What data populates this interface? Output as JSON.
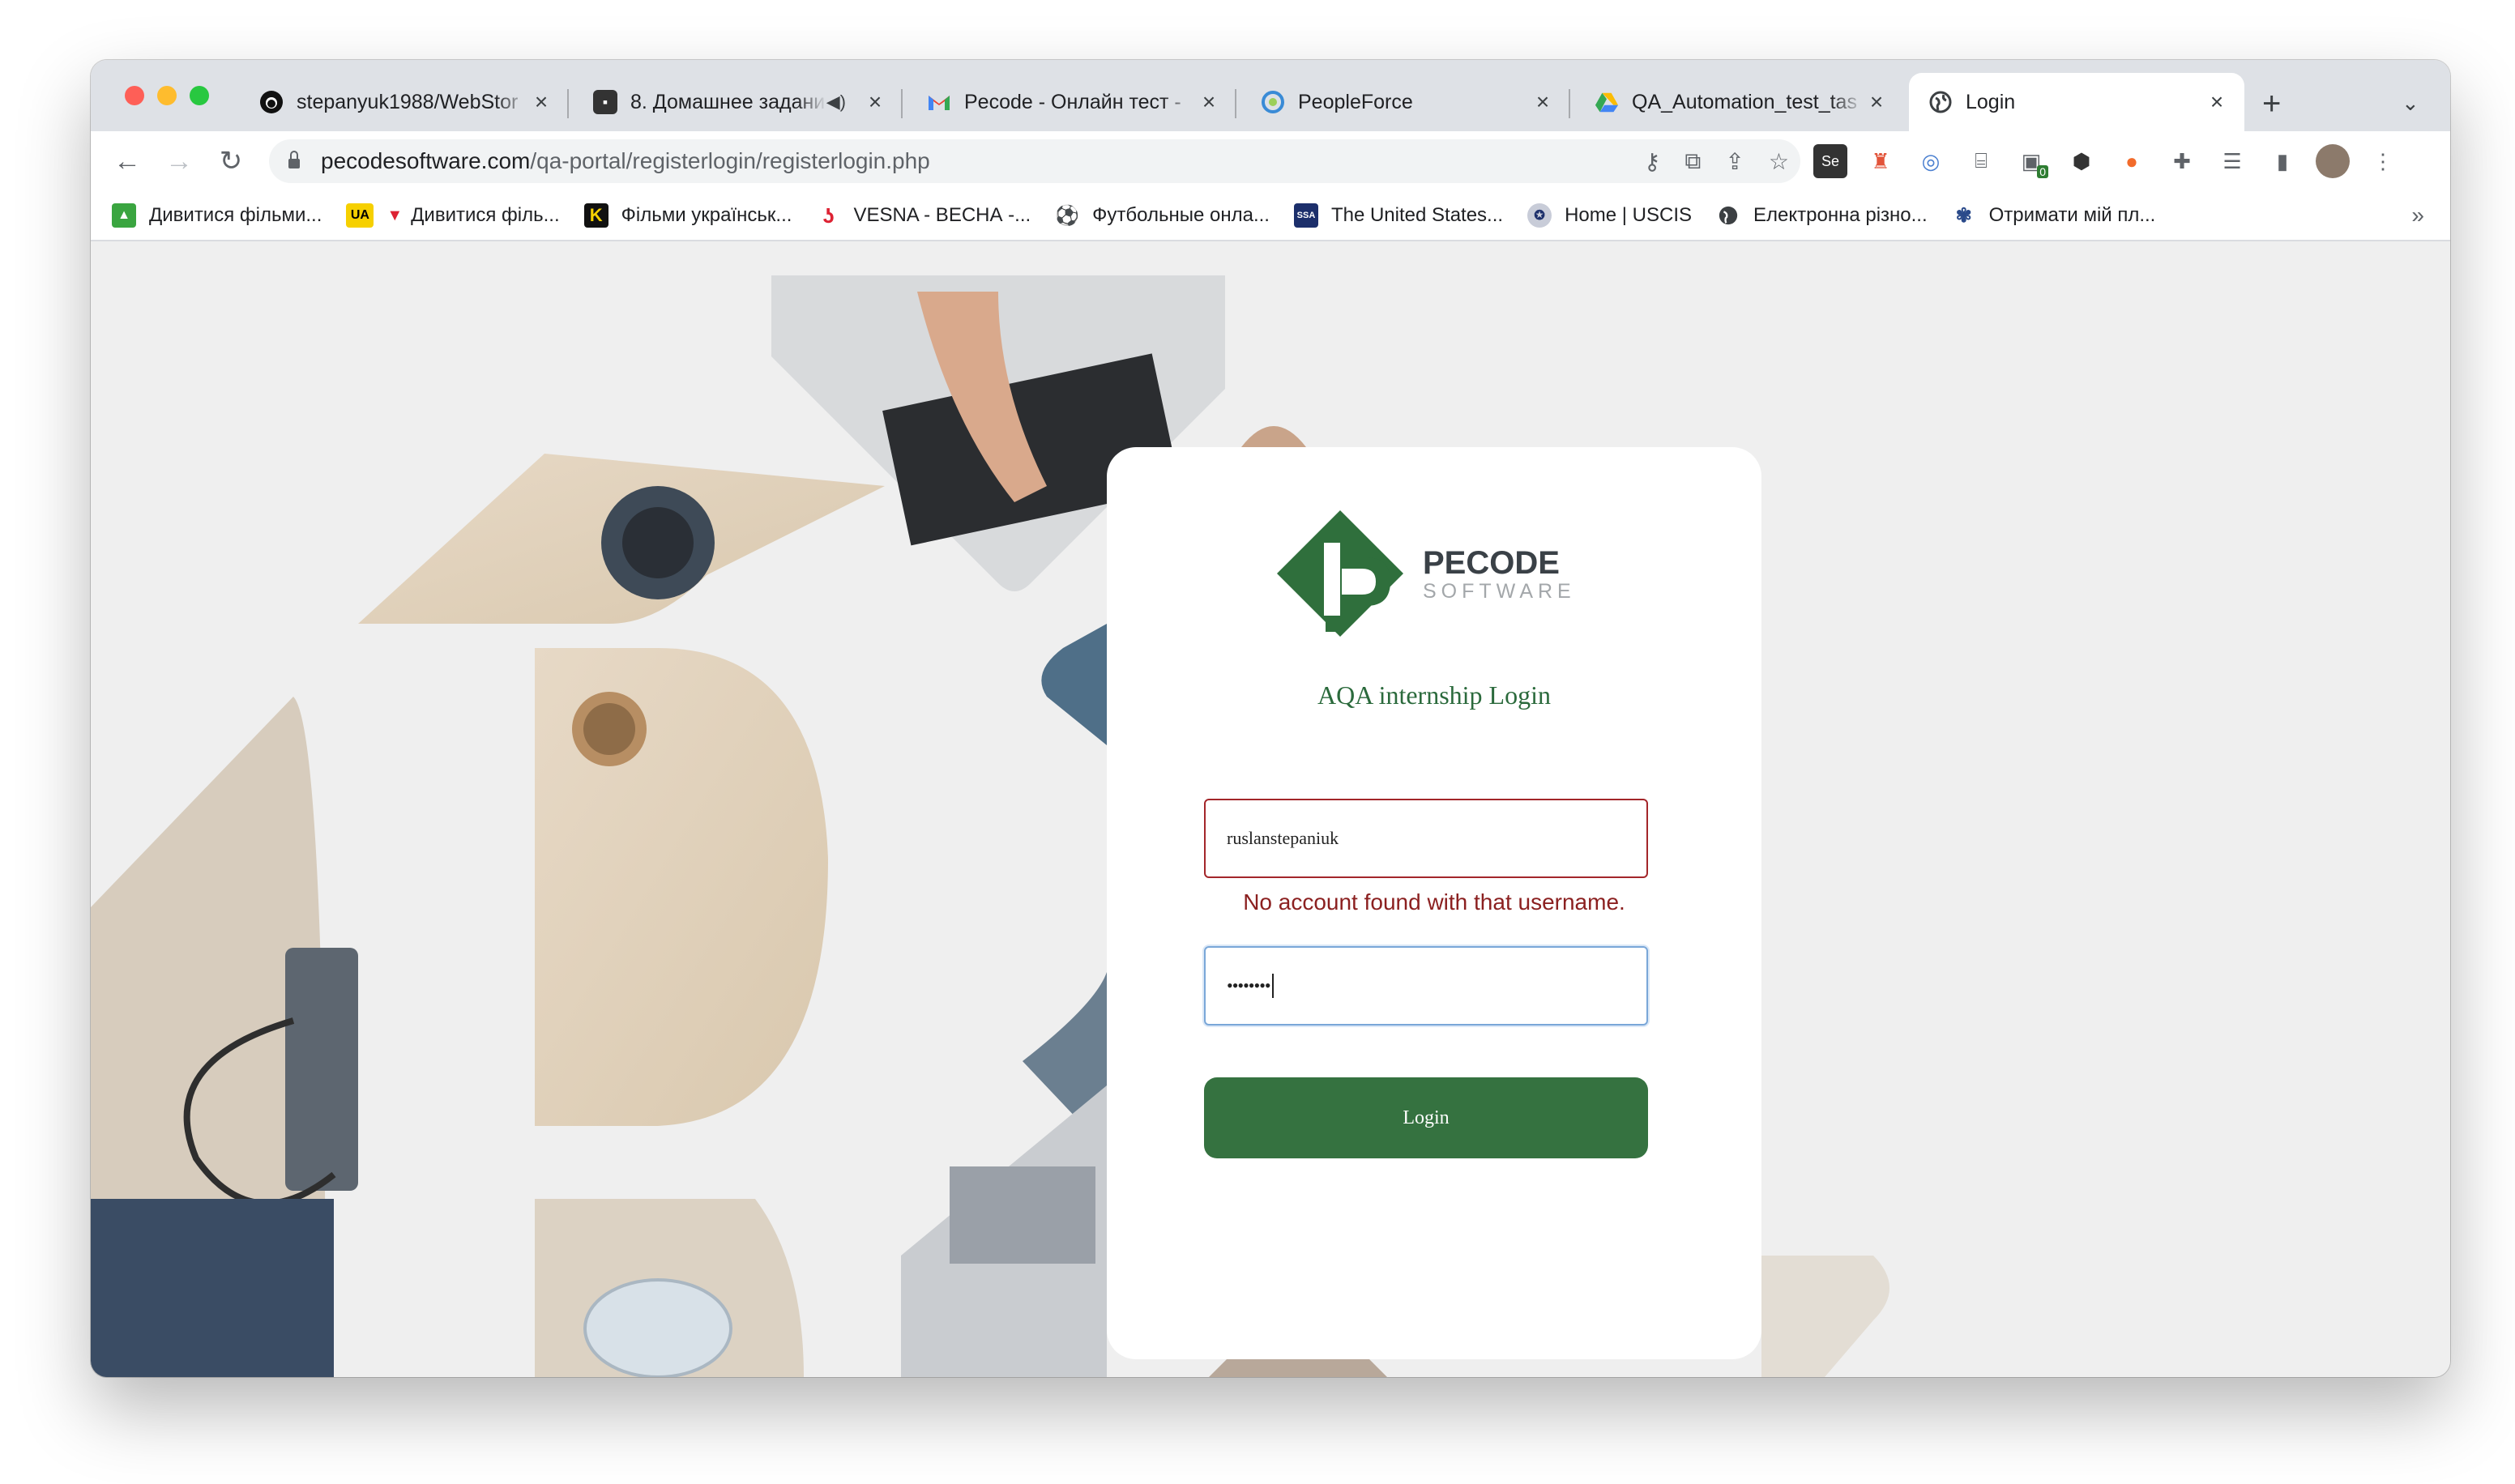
{
  "browser": {
    "tabs": [
      {
        "title": "stepanyuk1988/WebStor",
        "icon": "github-icon"
      },
      {
        "title": "8. Домашнее задани",
        "icon": "video-icon",
        "audio": true
      },
      {
        "title": "Pecode - Онлайн тест -",
        "icon": "gmail-icon"
      },
      {
        "title": "PeopleForce",
        "icon": "peopleforce-icon"
      },
      {
        "title": "QA_Automation_test_tas",
        "icon": "google-drive-icon"
      },
      {
        "title": "Login",
        "icon": "globe-icon",
        "active": true
      }
    ],
    "url_host": "pecodesoftware.com",
    "url_path": "/qa-portal/registerlogin/registerlogin.php",
    "bookmarks": [
      {
        "label": "Дивитися фільми...",
        "icon": "thumb-up-icon"
      },
      {
        "label": "Дивитися філь...",
        "icon": "ua-popcorn-icon"
      },
      {
        "label": "Фільми українськ...",
        "icon": "k-icon"
      },
      {
        "label": "VESNA - ВЕСНА -...",
        "icon": "vesna-icon"
      },
      {
        "label": "Футбольные онла...",
        "icon": "football-icon"
      },
      {
        "label": "The United States...",
        "icon": "ssa-icon"
      },
      {
        "label": "Home | USCIS",
        "icon": "uscis-icon"
      },
      {
        "label": "Електронна різно...",
        "icon": "globe-icon"
      },
      {
        "label": "Отримати мій пл...",
        "icon": "irs-icon"
      }
    ],
    "more_bookmarks": "»"
  },
  "login": {
    "logo_main": "PECODE",
    "logo_sub": "SOFTWARE",
    "title": "AQA internship Login",
    "username_value": "ruslanstepaniuk",
    "error": "No account found with that username.",
    "password_value": "••••••••",
    "button": "Login"
  },
  "colors": {
    "brand_green": "#357240",
    "error_red": "#8b2020"
  }
}
